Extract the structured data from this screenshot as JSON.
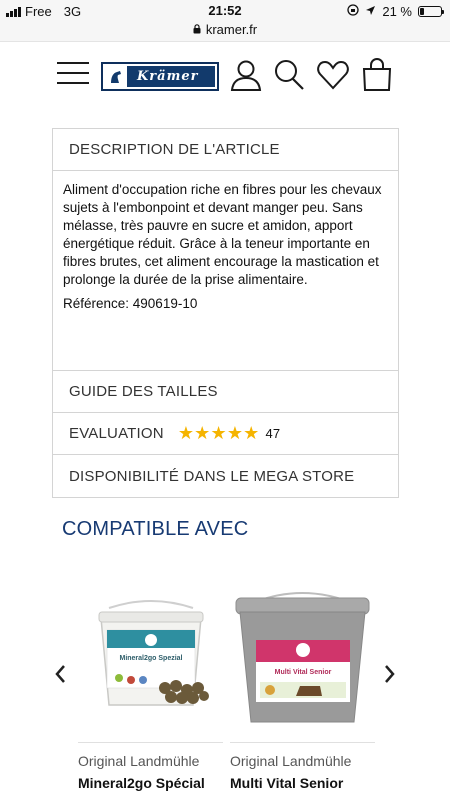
{
  "status_bar": {
    "carrier": "Free",
    "network": "3G",
    "time": "21:52",
    "battery": "21 %",
    "battery_level": 0.21
  },
  "browser": {
    "url": "kramer.fr"
  },
  "header": {
    "logo_text": "Krämer"
  },
  "accordion": {
    "description_title": "DESCRIPTION DE L'ARTICLE",
    "description_text": "Aliment d'occupation riche en fibres pour les chevaux sujets à l'embonpoint et devant manger peu. Sans mélasse, très pauvre en sucre et amidon, apport énergétique réduit. Grâce à la teneur importante en fibres brutes, cet aliment encourage la mastication et prolonge la durée de la prise alimentaire.",
    "reference": "Référence: 490619-10",
    "size_guide": "GUIDE DES TAILLES",
    "evaluation": "EVALUATION",
    "rating_stars": "★★★★★",
    "rating_value": 5,
    "rating_count": "47",
    "availability": "DISPONIBILITÉ DANS LE MEGA STORE"
  },
  "compatible": {
    "title": "COMPATIBLE AVEC",
    "products": [
      {
        "brand": "Original Landmühle",
        "name": "Mineral2go Spécial",
        "label_text": "Mineral2go Spezial",
        "accent": "#2e8fa0"
      },
      {
        "brand": "Original Landmühle",
        "name": "Multi Vital Senior",
        "label_text": "Multi Vital Senior",
        "accent": "#d0356b"
      }
    ]
  }
}
